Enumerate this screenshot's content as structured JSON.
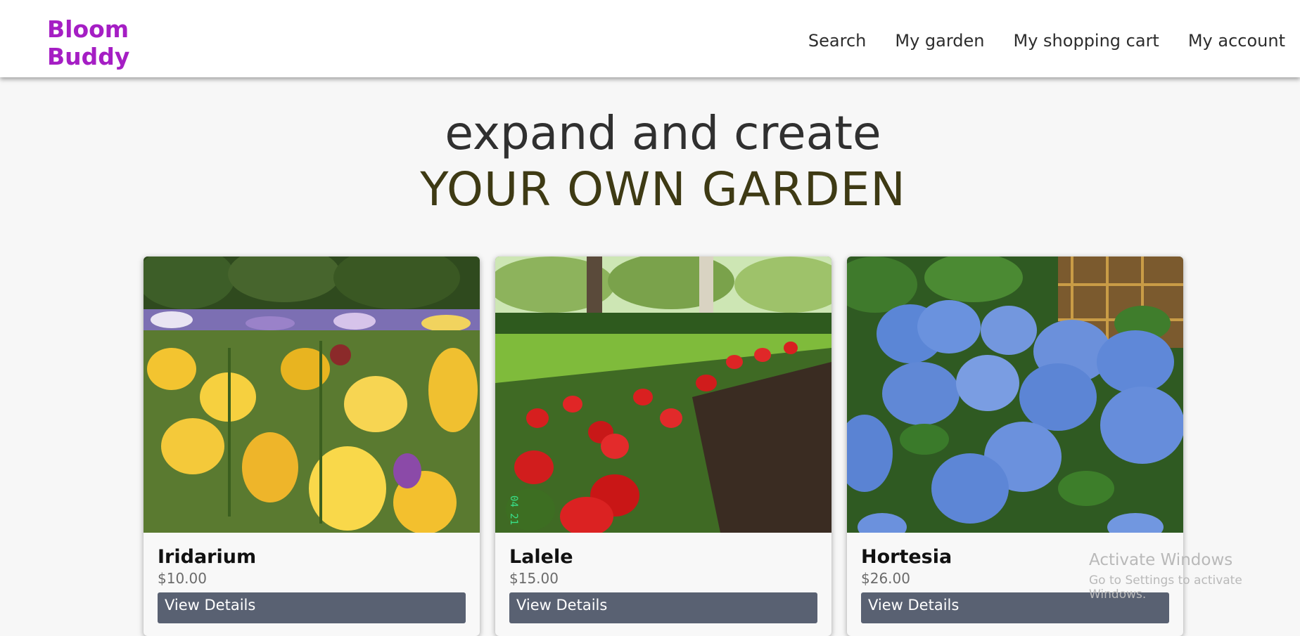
{
  "header": {
    "brand_line1": "Bloom",
    "brand_line2": "Buddy",
    "brand_color": "#a51ec4",
    "nav": [
      "Search",
      "My garden",
      "My shopping cart",
      "My account"
    ]
  },
  "hero": {
    "line1": "expand and create",
    "line2": "YOUR OWN GARDEN"
  },
  "products": [
    {
      "name": "Iridarium",
      "price": "$10.00",
      "button": "View Details",
      "image": "yellow-iris-field"
    },
    {
      "name": "Lalele",
      "price": "$15.00",
      "button": "View Details",
      "image": "red-tulip-garden",
      "image_caption": "04 21"
    },
    {
      "name": "Hortesia",
      "price": "$26.00",
      "button": "View Details",
      "image": "blue-hydrangea"
    }
  ],
  "watermark": {
    "title": "Activate Windows",
    "subtitle": "Go to Settings to activate Windows."
  },
  "colors": {
    "button_bg": "#596172",
    "hero_accent": "#3e3a14"
  }
}
